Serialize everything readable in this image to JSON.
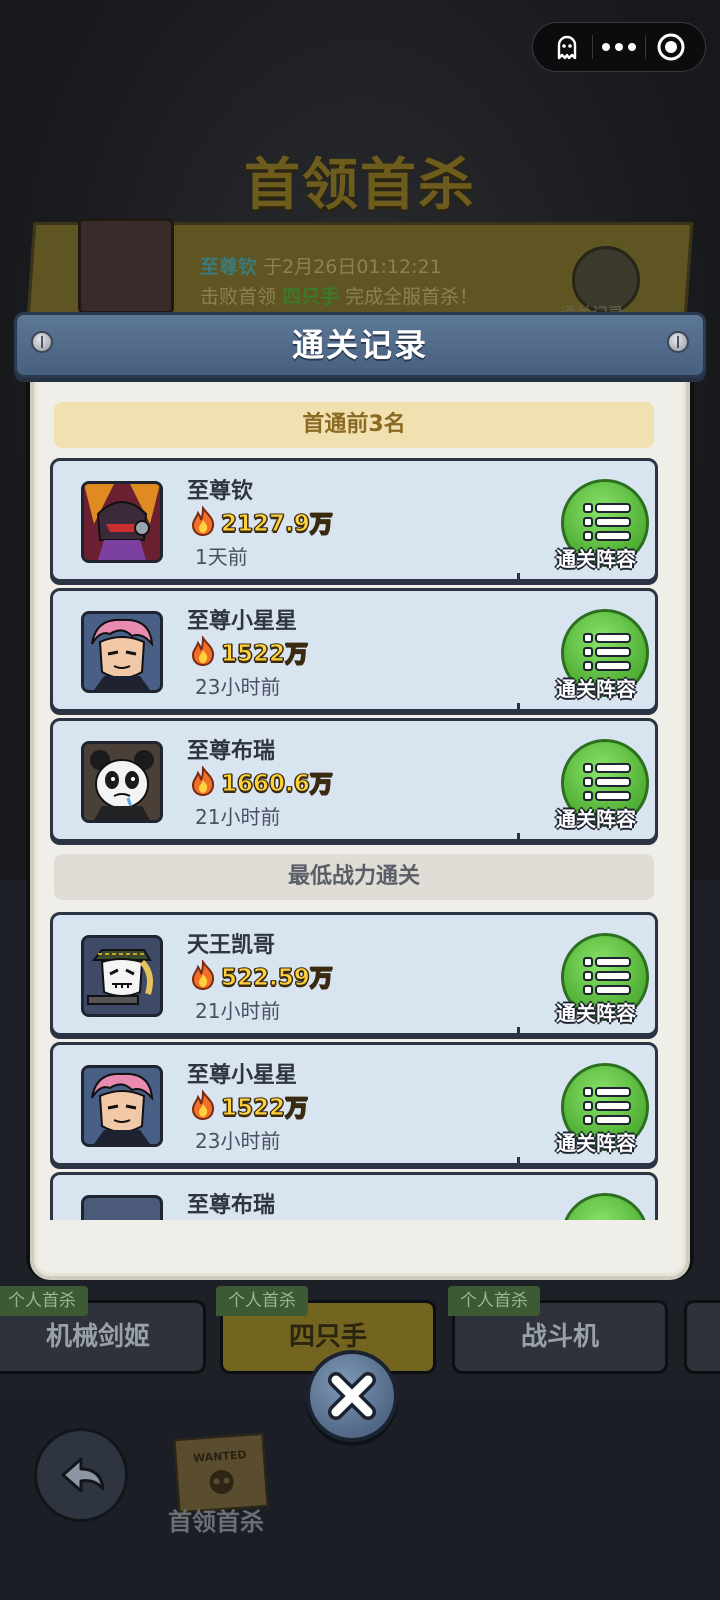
{
  "capsule": {
    "ghost_icon": "ghost-icon",
    "more_icon": "more-dots-icon",
    "close_icon": "target-circle-icon"
  },
  "background": {
    "title": "首领首杀",
    "announce_player": "至尊钦",
    "announce_time": "于2月26日01:12:21",
    "announce_line2_prefix": "击败首领",
    "announce_boss": "四只手",
    "announce_line2_suffix": "完成全服首杀！",
    "record_label": "通关记录"
  },
  "modal": {
    "title": "通关记录",
    "section_first": "首通前3名",
    "section_lowest": "最低战力通关",
    "lineup_label": "通关阵容",
    "first_clear": [
      {
        "name": "至尊钦",
        "power": "2127.9万",
        "time": "1天前",
        "avatar": "armored-hero"
      },
      {
        "name": "至尊小星星",
        "power": "1522万",
        "time": "23小时前",
        "avatar": "pink-hair-hero"
      },
      {
        "name": "至尊布瑞",
        "power": "1660.6万",
        "time": "21小时前",
        "avatar": "panda-hero"
      }
    ],
    "lowest_power": [
      {
        "name": "天王凯哥",
        "power": "522.59万",
        "time": "21小时前",
        "avatar": "masked-gunner-hero"
      },
      {
        "name": "至尊小星星",
        "power": "1522万",
        "time": "23小时前",
        "avatar": "pink-hair-hero"
      },
      {
        "name": "至尊布瑞",
        "power": "",
        "time": "",
        "avatar": "panda-hero"
      }
    ]
  },
  "boss_tabs": [
    {
      "badge": "个人首杀",
      "name": "机械剑姬"
    },
    {
      "badge": "个人首杀",
      "name": "四只手"
    },
    {
      "badge": "个人首杀",
      "name": "战斗机"
    }
  ],
  "footer": {
    "label": "首领首杀",
    "wanted_text": "WANTED"
  },
  "colors": {
    "accent_green": "#4fae33",
    "power_gold": "#ffd23d",
    "header_blue": "#48607f"
  }
}
